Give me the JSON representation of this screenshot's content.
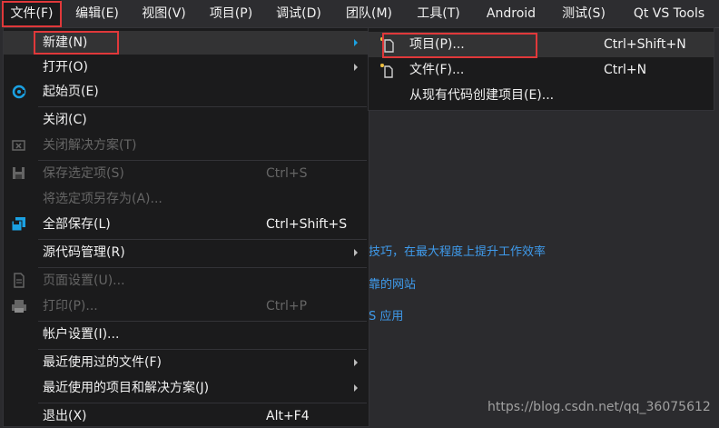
{
  "menubar": {
    "items": [
      "文件(F)",
      "编辑(E)",
      "视图(V)",
      "项目(P)",
      "调试(D)",
      "团队(M)",
      "工具(T)",
      "Android",
      "测试(S)",
      "Qt VS Tools"
    ]
  },
  "file_menu": {
    "new": {
      "label": "新建(N)"
    },
    "open": {
      "label": "打开(O)"
    },
    "start_page": {
      "label": "起始页(E)"
    },
    "close": {
      "label": "关闭(C)"
    },
    "close_solution": {
      "label": "关闭解决方案(T)"
    },
    "save_selected": {
      "label": "保存选定项(S)",
      "shortcut": "Ctrl+S"
    },
    "save_selected_as": {
      "label": "将选定项另存为(A)..."
    },
    "save_all": {
      "label": "全部保存(L)",
      "shortcut": "Ctrl+Shift+S"
    },
    "source_control": {
      "label": "源代码管理(R)"
    },
    "page_setup": {
      "label": "页面设置(U)..."
    },
    "print": {
      "label": "打印(P)...",
      "shortcut": "Ctrl+P"
    },
    "account_settings": {
      "label": "帐户设置(I)..."
    },
    "recent_files": {
      "label": "最近使用过的文件(F)"
    },
    "recent_projects": {
      "label": "最近使用的项目和解决方案(J)"
    },
    "exit": {
      "label": "退出(X)",
      "shortcut": "Alt+F4"
    }
  },
  "new_submenu": {
    "project": {
      "label": "项目(P)...",
      "shortcut": "Ctrl+Shift+N"
    },
    "file": {
      "label": "文件(F)...",
      "shortcut": "Ctrl+N"
    },
    "from_existing": {
      "label": "从现有代码创建项目(E)..."
    }
  },
  "background": {
    "link1": "技巧，在最大程度上提升工作效率",
    "link2": "靠的网站",
    "link3": "S 应用"
  },
  "watermark": "https://blog.csdn.net/qq_36075612",
  "colors": {
    "accent_red": "#e0383a",
    "link_blue": "#3f9bec",
    "menu_bg": "#1b1b1c",
    "menubar_bg": "#2d2d30",
    "disabled_text": "#656565"
  }
}
